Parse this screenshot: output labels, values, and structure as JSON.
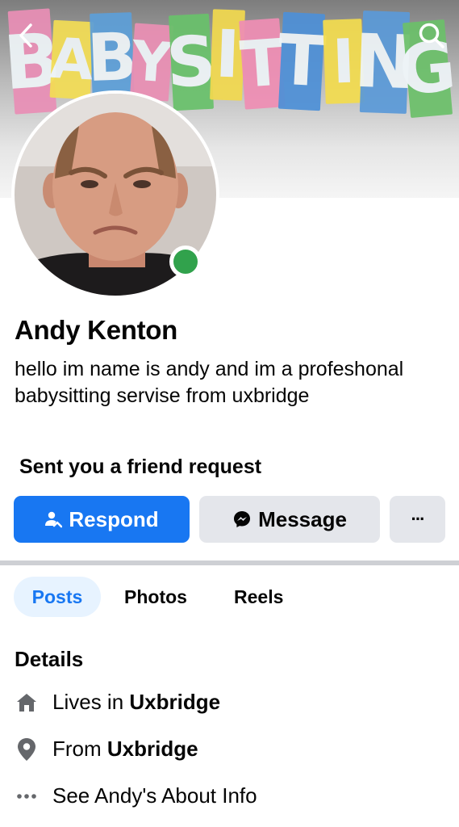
{
  "cover": {
    "letters": [
      "B",
      "A",
      "B",
      "Y",
      "S",
      "I",
      "T",
      "T",
      "I",
      "N",
      "G"
    ],
    "letter_colors": [
      "#e98fb6",
      "#f3dd55",
      "#5d9fd8",
      "#ea8fb4",
      "#69c16b",
      "#f2d94f",
      "#ef8eb4",
      "#4e90d7",
      "#f3dc4f",
      "#5b9ad8",
      "#6cc06a"
    ]
  },
  "profile": {
    "name": "Andy Kenton",
    "bio": "hello im name is andy and im a profeshonal babysitting servise from uxbridge",
    "friend_request": "Sent you a friend request"
  },
  "actions": {
    "respond": "Respond",
    "message": "Message",
    "more": "···"
  },
  "tabs": [
    "Posts",
    "Photos",
    "Reels"
  ],
  "details": {
    "title": "Details",
    "lives_prefix": "Lives in ",
    "lives_place": "Uxbridge",
    "from_prefix": "From ",
    "from_place": "Uxbridge",
    "about": "See Andy's About Info"
  },
  "colors": {
    "accent": "#1877f2",
    "online": "#31a24c",
    "button_gray": "#e4e6eb"
  }
}
